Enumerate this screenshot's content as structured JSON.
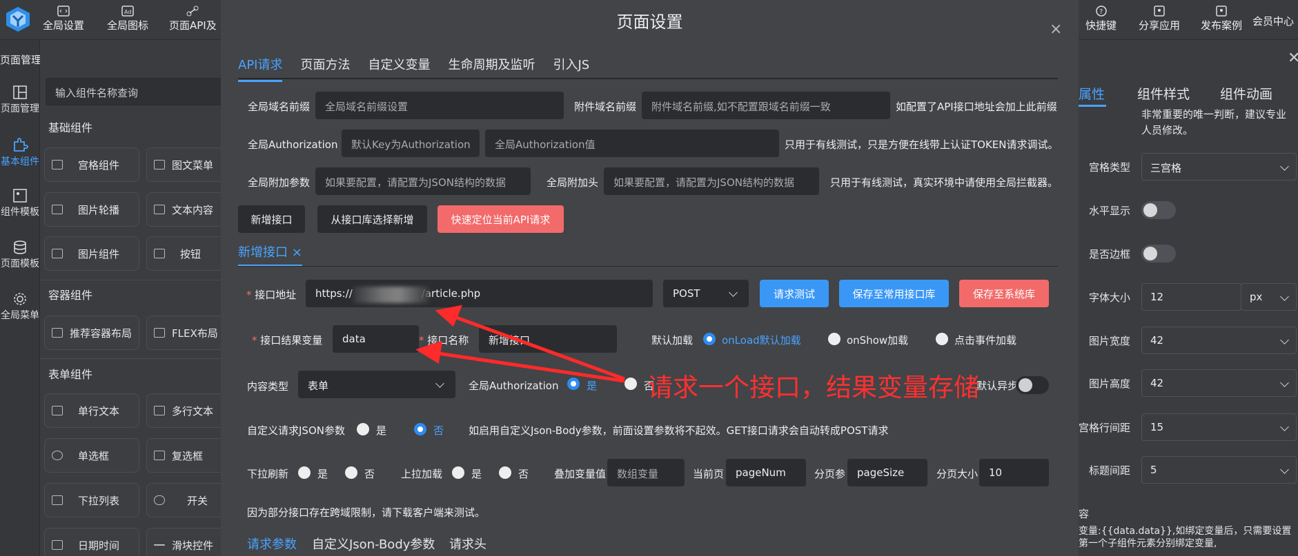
{
  "toolbar": {
    "items": [
      "全局设置",
      "全局图标",
      "页面API及",
      "快捷键",
      "分享应用",
      "发布案例",
      "会员中心"
    ]
  },
  "left": {
    "header": "页面管理",
    "nav": [
      "页面管理",
      "基本组件",
      "组件模板",
      "页面模板",
      "全局菜单"
    ],
    "search_placeholder": "输入组件名称查询",
    "sections": [
      "基础组件",
      "容器组件",
      "表单组件"
    ],
    "basic": [
      "宫格组件",
      "图文菜单",
      "图片轮播",
      "文本内容",
      "图片组件",
      "按钮"
    ],
    "container": [
      "推荐容器布局",
      "FLEX布局"
    ],
    "form": [
      "单行文本",
      "多行文本",
      "单选框",
      "复选框",
      "下拉列表",
      "开关",
      "日期时间",
      "滑块控件"
    ]
  },
  "right": {
    "tabs": [
      "属性",
      "组件样式",
      "组件动画"
    ],
    "note": "非常重要的唯一判断，建议专业人员修改。",
    "rows": [
      {
        "label": "宫格类型",
        "value": "三宫格"
      },
      {
        "label": "水平显示"
      },
      {
        "label": "是否边框"
      },
      {
        "label": "字体大小",
        "value": "12",
        "unit": "px"
      },
      {
        "label": "图片宽度",
        "value": "42"
      },
      {
        "label": "图片高度",
        "value": "42"
      },
      {
        "label": "宫格行间距",
        "value": "15"
      },
      {
        "label": "标题间距",
        "value": "5"
      }
    ],
    "content_label": "容",
    "content_text": "变量:{{data.data}},如绑定变量后，只需要设置第一个子组件元素分别绑定变量,"
  },
  "modal": {
    "title": "页面设置",
    "close": "×",
    "tabs": [
      "API请求",
      "页面方法",
      "自定义变量",
      "生命周期及监听",
      "引入JS"
    ],
    "global_domain_label": "全局域名前缀",
    "global_domain_placeholder": "全局域名前缀设置",
    "attach_domain_label": "附件域名前缀",
    "attach_domain_placeholder": "附件域名前缀,如不配置跟域名前缀一致",
    "attach_domain_hint": "如配置了API接口地址会加上此前缀",
    "auth_label": "全局Authorization",
    "auth_key_placeholder": "默认Key为Authorization",
    "auth_value_placeholder": "全局Authorization值",
    "auth_hint": "只用于有线测试，只是方便在线带上认证TOKEN请求调试。",
    "params_label": "全局附加参数",
    "params_placeholder": "如果要配置，请配置为JSON结构的数据",
    "header_label": "全局附加头",
    "header_placeholder": "如果要配置，请配置为JSON结构的数据",
    "header_hint": "只用于有线测试，真实环境中请使用全局拦截器。",
    "btn_add": "新增接口",
    "btn_from_lib": "从接口库选择新增",
    "btn_locate": "快速定位当前API请求",
    "sub_tab": "新增接口",
    "sub_tab_close": "×",
    "url_label": "接口地址",
    "url_value": "https://",
    "url_suffix": "/article.php",
    "method": "POST",
    "btn_test": "请求测试",
    "btn_save_common": "保存至常用接口库",
    "btn_save_sys": "保存至系统库",
    "result_label": "接口结果变量",
    "result_value": "data",
    "name_label": "接口名称",
    "name_value": "新增接口",
    "default_load_label": "默认加载",
    "load_opts": [
      "onLoad默认加载",
      "onShow加载",
      "点击事件加载"
    ],
    "content_type_label": "内容类型",
    "content_type_value": "表单",
    "global_auth_label": "全局Authorization",
    "yes": "是",
    "no": "否",
    "async_label": "默认异步",
    "custom_json_label": "自定义请求JSON参数",
    "custom_json_hint": "如启用自定义Json-Body参数，前面设置参数将不起效。GET接口请求会自动转成POST请求",
    "pull_refresh_label": "下拉刷新",
    "pull_load_label": "上拉加载",
    "stack_label": "叠加变量值",
    "stack_placeholder": "数组变量",
    "cur_page_label": "当前页",
    "cur_page_value": "pageNum",
    "page_param_label": "分页参",
    "page_param_value": "pageSize",
    "page_size_label": "分页大小",
    "page_size_value": "10",
    "cors_note": "因为部分接口存在跨域限制，请下载客户端来测试。",
    "bottom_tabs": [
      "请求参数",
      "自定义Json-Body参数",
      "请求头"
    ],
    "annotation": "请求一个接口，结果变量存储"
  }
}
